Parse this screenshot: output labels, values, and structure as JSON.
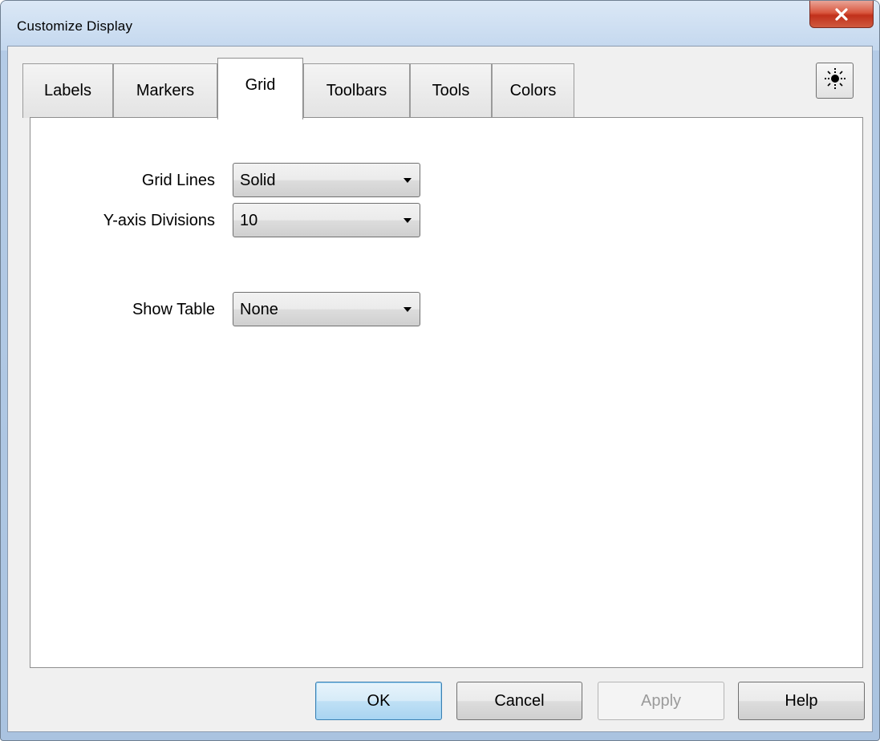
{
  "window": {
    "title": "Customize Display"
  },
  "tabs": [
    {
      "label": "Labels",
      "active": false
    },
    {
      "label": "Markers",
      "active": false
    },
    {
      "label": "Grid",
      "active": true
    },
    {
      "label": "Toolbars",
      "active": false
    },
    {
      "label": "Tools",
      "active": false
    },
    {
      "label": "Colors",
      "active": false
    }
  ],
  "toolbar_icon": "sun-icon",
  "fields": {
    "grid_lines": {
      "label": "Grid Lines",
      "value": "Solid"
    },
    "y_axis_divisions": {
      "label": "Y-axis Divisions",
      "value": "10"
    },
    "show_table": {
      "label": "Show Table",
      "value": "None"
    }
  },
  "buttons": {
    "ok": "OK",
    "cancel": "Cancel",
    "apply": {
      "label": "Apply",
      "enabled": false
    },
    "help": "Help"
  },
  "colors": {
    "close_button": "#c7412a",
    "default_button_border": "#3c7fb1",
    "panel_background": "#ffffff",
    "dialog_background": "#f0f0f0"
  }
}
